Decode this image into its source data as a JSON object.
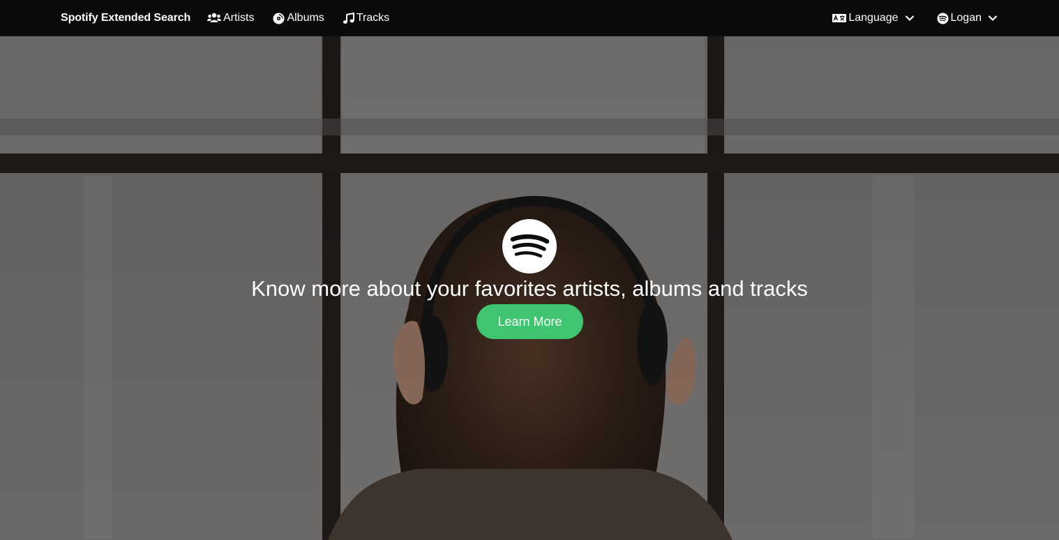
{
  "nav": {
    "brand": "Spotify Extended Search",
    "items": [
      {
        "label": "Artists",
        "icon": "users-icon"
      },
      {
        "label": "Albums",
        "icon": "record-icon"
      },
      {
        "label": "Tracks",
        "icon": "music-note-icon"
      }
    ],
    "language": {
      "label": "Language",
      "icon": "translate-icon"
    },
    "user": {
      "label": "Logan",
      "icon": "spotify-icon"
    }
  },
  "hero": {
    "headline": "Know more about your favorites artists, albums and tracks",
    "cta_label": "Learn More",
    "logo_icon": "spotify-logo-icon"
  },
  "colors": {
    "navbar_bg": "#0b0b0b",
    "cta_bg": "#3fc46f",
    "text": "#ffffff"
  }
}
